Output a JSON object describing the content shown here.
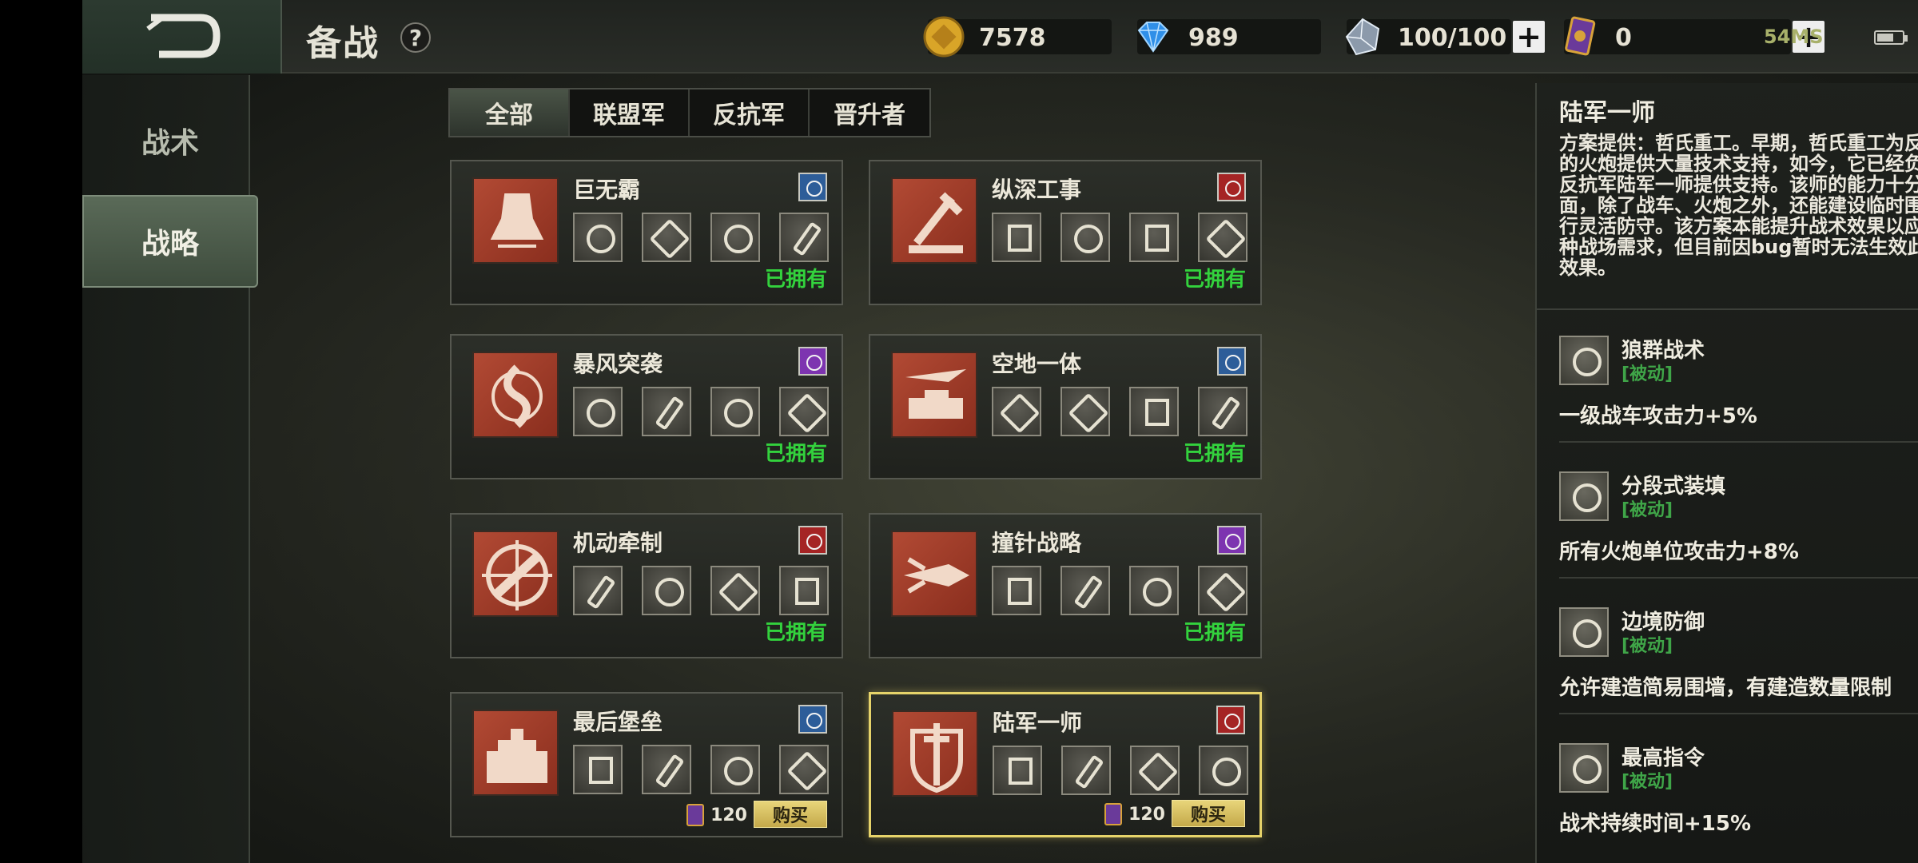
{
  "header": {
    "title": "备战",
    "help_label": "?",
    "gold": "7578",
    "diamonds": "989",
    "crystal": "100/100",
    "cards": "0",
    "plus_label": "+",
    "network": "54MS"
  },
  "sidenav": {
    "items": [
      {
        "label": "战术",
        "active": false
      },
      {
        "label": "战略",
        "active": true
      }
    ]
  },
  "tabs": [
    {
      "label": "全部",
      "active": true
    },
    {
      "label": "联盟军",
      "active": false
    },
    {
      "label": "反抗军",
      "active": false
    },
    {
      "label": "晋升者",
      "active": false
    }
  ],
  "cards": [
    {
      "name": "巨无霸",
      "faction": "blue",
      "status": "已拥有"
    },
    {
      "name": "纵深工事",
      "faction": "red",
      "status": "已拥有"
    },
    {
      "name": "暴风突袭",
      "faction": "purple",
      "status": "已拥有"
    },
    {
      "name": "空地一体",
      "faction": "blue",
      "status": "已拥有"
    },
    {
      "name": "机动牵制",
      "faction": "red",
      "status": "已拥有"
    },
    {
      "name": "撞针战略",
      "faction": "purple",
      "status": "已拥有"
    },
    {
      "name": "最后堡垒",
      "faction": "blue",
      "price": "120",
      "buy_label": "购买"
    },
    {
      "name": "陆军一师",
      "faction": "red",
      "price": "120",
      "buy_label": "购买",
      "selected": true
    }
  ],
  "detail": {
    "title": "陆军一师",
    "description": "方案提供：哲氏重工。早期，哲氏重工为反抗军的火炮提供大量技术支持，如今，它已经负责给反抗军陆军一师提供支持。该师的能力十分全面，除了战车、火炮之外，还能建设临时围墙进行灵活防守。该方案本能提升战术效果以应对各种战场需求，但目前因bug暂时无法生效此技能效果。",
    "skills": [
      {
        "name": "狼群战术",
        "type": "[被动]",
        "effect": "一级战车攻击力+5%"
      },
      {
        "name": "分段式装填",
        "type": "[被动]",
        "effect": "所有火炮单位攻击力+8%"
      },
      {
        "name": "边境防御",
        "type": "[被动]",
        "effect": "允许建造简易围墙，有建造数量限制"
      },
      {
        "name": "最高指令",
        "type": "[被动]",
        "effect": "战术持续时间+15%"
      }
    ]
  }
}
